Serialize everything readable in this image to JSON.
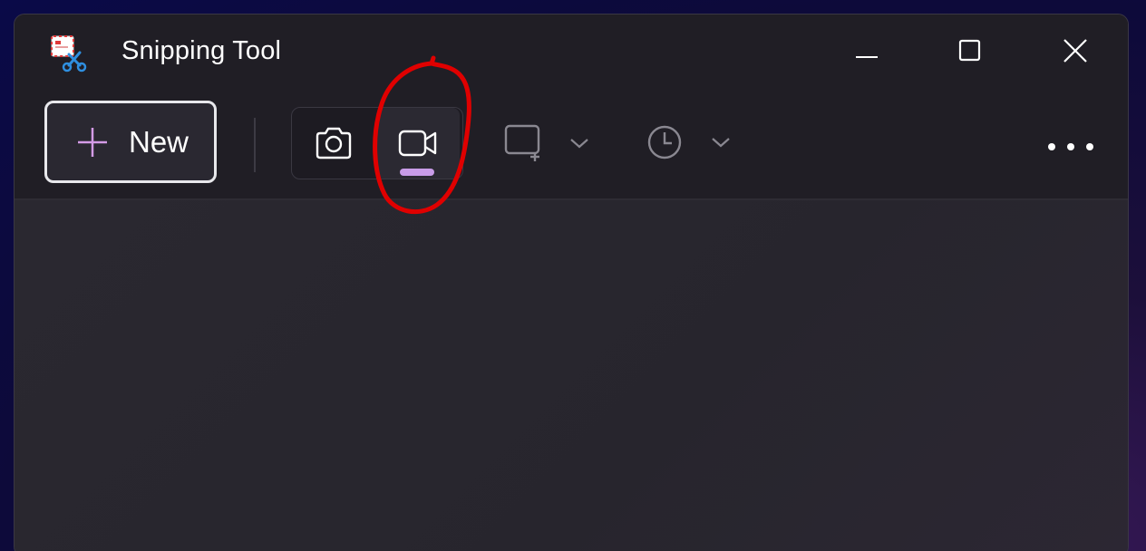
{
  "window": {
    "title": "Snipping Tool",
    "controls": {
      "minimize_icon": "minimize-icon",
      "maximize_icon": "maximize-icon",
      "close_icon": "close-icon"
    }
  },
  "toolbar": {
    "new_label": "New",
    "modes": [
      {
        "name": "Snip",
        "icon": "camera-icon",
        "selected": false
      },
      {
        "name": "Record",
        "icon": "video-camera-icon",
        "selected": true
      }
    ],
    "snip_mode_icon": "rectangle-snip-icon",
    "delay_icon": "clock-icon",
    "more_icon": "more-icon"
  },
  "colors": {
    "accent": "#c99ce8",
    "background": "#232129",
    "annotation": "#e00000"
  }
}
